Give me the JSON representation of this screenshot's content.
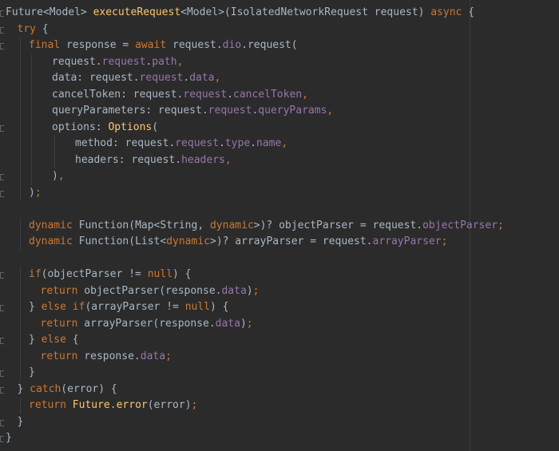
{
  "editor": {
    "language": "dart",
    "colors": {
      "background": "#2b2b2b",
      "keyword": "#cc7832",
      "function": "#ffc66d",
      "field": "#9876aa",
      "plain": "#a9b7c6"
    },
    "lines": [
      {
        "indent": 0,
        "tokens": [
          {
            "t": "Future<Model> ",
            "c": "plain"
          },
          {
            "t": "executeRequest",
            "c": "fn"
          },
          {
            "t": "<Model>(IsolatedNetworkRequest request) ",
            "c": "plain"
          },
          {
            "t": "async",
            "c": "kw"
          },
          {
            "t": " {",
            "c": "plain"
          }
        ]
      },
      {
        "indent": 1,
        "tokens": [
          {
            "t": "try",
            "c": "kw"
          },
          {
            "t": " {",
            "c": "plain"
          }
        ]
      },
      {
        "indent": 2,
        "tokens": [
          {
            "t": "final",
            "c": "kw"
          },
          {
            "t": " response = ",
            "c": "plain"
          },
          {
            "t": "await",
            "c": "kw"
          },
          {
            "t": " request.",
            "c": "plain"
          },
          {
            "t": "dio",
            "c": "field"
          },
          {
            "t": ".request(",
            "c": "plain"
          }
        ]
      },
      {
        "indent": 4,
        "tokens": [
          {
            "t": "request.",
            "c": "plain"
          },
          {
            "t": "request",
            "c": "field"
          },
          {
            "t": ".",
            "c": "plain"
          },
          {
            "t": "path",
            "c": "field"
          },
          {
            "t": ",",
            "c": "kw"
          }
        ]
      },
      {
        "indent": 4,
        "tokens": [
          {
            "t": "data: request.",
            "c": "plain"
          },
          {
            "t": "request",
            "c": "field"
          },
          {
            "t": ".",
            "c": "plain"
          },
          {
            "t": "data",
            "c": "field"
          },
          {
            "t": ",",
            "c": "kw"
          }
        ]
      },
      {
        "indent": 4,
        "tokens": [
          {
            "t": "cancelToken: request.",
            "c": "plain"
          },
          {
            "t": "request",
            "c": "field"
          },
          {
            "t": ".",
            "c": "plain"
          },
          {
            "t": "cancelToken",
            "c": "field"
          },
          {
            "t": ",",
            "c": "kw"
          }
        ]
      },
      {
        "indent": 4,
        "tokens": [
          {
            "t": "queryParameters: request.",
            "c": "plain"
          },
          {
            "t": "request",
            "c": "field"
          },
          {
            "t": ".",
            "c": "plain"
          },
          {
            "t": "queryParams",
            "c": "field"
          },
          {
            "t": ",",
            "c": "kw"
          }
        ]
      },
      {
        "indent": 4,
        "tokens": [
          {
            "t": "options: ",
            "c": "plain"
          },
          {
            "t": "Options",
            "c": "fn"
          },
          {
            "t": "(",
            "c": "plain"
          }
        ]
      },
      {
        "indent": 6,
        "tokens": [
          {
            "t": "method: request.",
            "c": "plain"
          },
          {
            "t": "request",
            "c": "field"
          },
          {
            "t": ".",
            "c": "plain"
          },
          {
            "t": "type",
            "c": "field"
          },
          {
            "t": ".",
            "c": "plain"
          },
          {
            "t": "name",
            "c": "field"
          },
          {
            "t": ",",
            "c": "kw"
          }
        ]
      },
      {
        "indent": 6,
        "tokens": [
          {
            "t": "headers: request.",
            "c": "plain"
          },
          {
            "t": "headers",
            "c": "field"
          },
          {
            "t": ",",
            "c": "kw"
          }
        ]
      },
      {
        "indent": 4,
        "tokens": [
          {
            "t": ")",
            "c": "plain"
          },
          {
            "t": ",",
            "c": "kw"
          }
        ]
      },
      {
        "indent": 2,
        "tokens": [
          {
            "t": ")",
            "c": "plain"
          },
          {
            "t": ";",
            "c": "kw"
          }
        ]
      },
      {
        "indent": 0,
        "tokens": []
      },
      {
        "indent": 2,
        "tokens": [
          {
            "t": "dynamic",
            "c": "kw"
          },
          {
            "t": " Function(Map<String, ",
            "c": "plain"
          },
          {
            "t": "dynamic",
            "c": "kw"
          },
          {
            "t": ">)? objectParser = request.",
            "c": "plain"
          },
          {
            "t": "objectParser",
            "c": "field"
          },
          {
            "t": ";",
            "c": "kw"
          }
        ]
      },
      {
        "indent": 2,
        "tokens": [
          {
            "t": "dynamic",
            "c": "kw"
          },
          {
            "t": " Function(List<",
            "c": "plain"
          },
          {
            "t": "dynamic",
            "c": "kw"
          },
          {
            "t": ">)? arrayParser = request.",
            "c": "plain"
          },
          {
            "t": "arrayParser",
            "c": "field"
          },
          {
            "t": ";",
            "c": "kw"
          }
        ]
      },
      {
        "indent": 0,
        "tokens": []
      },
      {
        "indent": 2,
        "tokens": [
          {
            "t": "if",
            "c": "kw"
          },
          {
            "t": "(objectParser != ",
            "c": "plain"
          },
          {
            "t": "null",
            "c": "kw"
          },
          {
            "t": ") {",
            "c": "plain"
          }
        ]
      },
      {
        "indent": 3,
        "tokens": [
          {
            "t": "return",
            "c": "kw"
          },
          {
            "t": " objectParser(response.",
            "c": "plain"
          },
          {
            "t": "data",
            "c": "field"
          },
          {
            "t": ")",
            "c": "plain"
          },
          {
            "t": ";",
            "c": "kw"
          }
        ]
      },
      {
        "indent": 2,
        "tokens": [
          {
            "t": "} ",
            "c": "plain"
          },
          {
            "t": "else if",
            "c": "kw"
          },
          {
            "t": "(arrayParser != ",
            "c": "plain"
          },
          {
            "t": "null",
            "c": "kw"
          },
          {
            "t": ") {",
            "c": "plain"
          }
        ]
      },
      {
        "indent": 3,
        "tokens": [
          {
            "t": "return",
            "c": "kw"
          },
          {
            "t": " arrayParser(response.",
            "c": "plain"
          },
          {
            "t": "data",
            "c": "field"
          },
          {
            "t": ")",
            "c": "plain"
          },
          {
            "t": ";",
            "c": "kw"
          }
        ]
      },
      {
        "indent": 2,
        "tokens": [
          {
            "t": "} ",
            "c": "plain"
          },
          {
            "t": "else",
            "c": "kw"
          },
          {
            "t": " {",
            "c": "plain"
          }
        ]
      },
      {
        "indent": 3,
        "tokens": [
          {
            "t": "return",
            "c": "kw"
          },
          {
            "t": " response.",
            "c": "plain"
          },
          {
            "t": "data",
            "c": "field"
          },
          {
            "t": ";",
            "c": "kw"
          }
        ]
      },
      {
        "indent": 2,
        "tokens": [
          {
            "t": "}",
            "c": "plain"
          }
        ]
      },
      {
        "indent": 1,
        "tokens": [
          {
            "t": "} ",
            "c": "plain"
          },
          {
            "t": "catch",
            "c": "kw"
          },
          {
            "t": "(error) {",
            "c": "plain"
          }
        ]
      },
      {
        "indent": 2,
        "tokens": [
          {
            "t": "return",
            "c": "kw"
          },
          {
            "t": " ",
            "c": "plain"
          },
          {
            "t": "Future",
            "c": "fn"
          },
          {
            "t": ".",
            "c": "plain"
          },
          {
            "t": "error",
            "c": "fn"
          },
          {
            "t": "(error)",
            "c": "plain"
          },
          {
            "t": ";",
            "c": "kw"
          }
        ]
      },
      {
        "indent": 1,
        "tokens": [
          {
            "t": "}",
            "c": "plain"
          }
        ]
      },
      {
        "indent": 0,
        "tokens": [
          {
            "t": "}",
            "c": "plain"
          }
        ]
      }
    ]
  }
}
